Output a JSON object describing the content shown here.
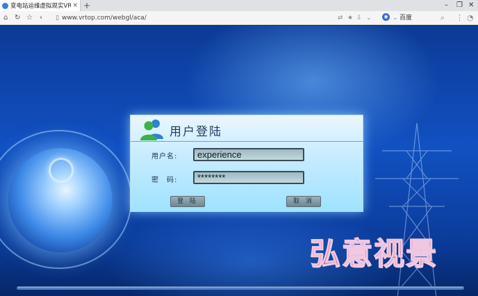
{
  "browser": {
    "tab_title": "变电站运维虚拟现实VR",
    "tab_close": "×",
    "new_tab": "+",
    "url": "www.vrtop.com/webgl/aca/",
    "search_engine_label": "百度",
    "window_controls": {
      "minimize": "–",
      "maximize": "❐",
      "close": "✕"
    },
    "nav_icons": {
      "home": "⌂",
      "reload": "↻",
      "favorite": "☆",
      "back": "‹"
    },
    "addr_icons": {
      "translate": "⇄",
      "star": "★",
      "downloads": "⇩",
      "dropdown": "⌄",
      "search": "⌕",
      "menu": "⋮",
      "user": "◔"
    }
  },
  "login": {
    "title": "用户登陆",
    "username_label": "用户名:",
    "username_value": "experience",
    "password_label": "密　码:",
    "password_value": "********",
    "login_button": "登 陆",
    "cancel_button": "取 消"
  },
  "watermark": "弘意视景",
  "loading_progress": 1.0,
  "colors": {
    "background": "#1151c2",
    "panel": "#c9ecff",
    "watermark": "#c14a8c"
  },
  "icons": [
    "users-icon",
    "globe-graphic",
    "power-tower-graphic"
  ]
}
